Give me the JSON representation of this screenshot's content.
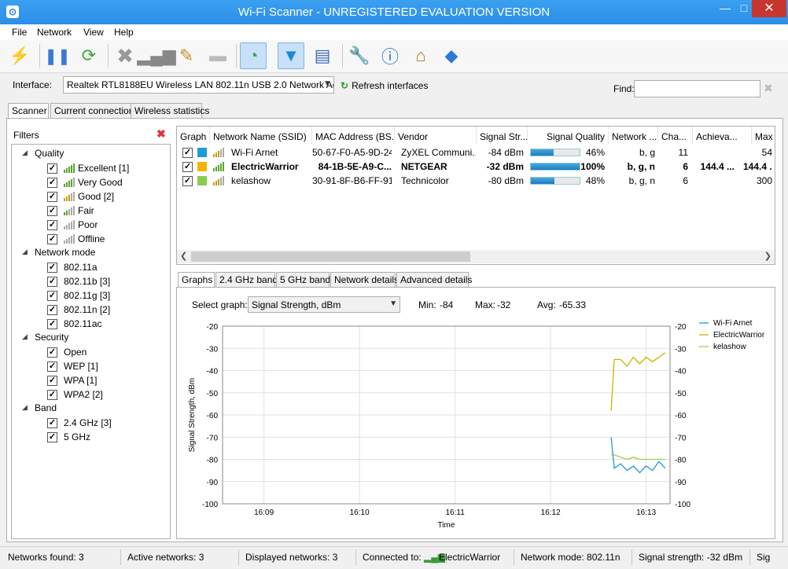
{
  "window": {
    "title": "Wi-Fi Scanner - UNREGISTERED EVALUATION VERSION",
    "minimize": "—",
    "maximize": "□",
    "close": "✕"
  },
  "menu": [
    "File",
    "Network",
    "View",
    "Help"
  ],
  "toolbar": {
    "icons": [
      "power-off-icon",
      "pause-icon",
      "refresh-icon",
      "delete-icon",
      "signal-remove-icon",
      "broom-icon",
      "folder-icon",
      "wifi-scan-icon",
      "filter-icon",
      "notebook-icon",
      "wrench-icon",
      "help-icon",
      "home-icon",
      "info-icon"
    ]
  },
  "interface": {
    "label": "Interface:",
    "value": "Realtek RTL8188EU Wireless LAN 802.11n USB 2.0 Network Adapter",
    "refresh_label": "Refresh interfaces",
    "find_label": "Find:",
    "find_value": ""
  },
  "top_tabs": [
    "Scanner",
    "Current connection",
    "Wireless statistics"
  ],
  "filters": {
    "title": "Filters",
    "groups": [
      {
        "name": "Quality",
        "items": [
          "Excellent [1]",
          "Very Good",
          "Good [2]",
          "Fair",
          "Poor",
          "Offline"
        ]
      },
      {
        "name": "Network mode",
        "items": [
          "802.11a",
          "802.11b [3]",
          "802.11g [3]",
          "802.11n [2]",
          "802.11ac"
        ]
      },
      {
        "name": "Security",
        "items": [
          "Open",
          "WEP [1]",
          "WPA [1]",
          "WPA2 [2]"
        ]
      },
      {
        "name": "Band",
        "items": [
          "2.4 GHz [3]",
          "5 GHz"
        ]
      }
    ]
  },
  "table": {
    "columns": [
      "Graph",
      "Network Name (SSID)",
      "MAC Address (BS...",
      "Vendor",
      "Signal Str...",
      "Signal Quality",
      "Network ...",
      "Cha...",
      "Achieva...",
      "Max"
    ],
    "rows": [
      {
        "color": "#1e9ad6",
        "ssid": "Wi-Fi Arnet",
        "mac": "50-67-F0-A5-9D-24",
        "vendor": "ZyXEL Communi...",
        "signal": "-84 dBm",
        "quality": "46%",
        "quality_value": 46,
        "mode": "b, g",
        "channel": "11",
        "achievable": "",
        "max": "54",
        "bold": false
      },
      {
        "color": "#f2b600",
        "ssid": "ElectricWarrior",
        "mac": "84-1B-5E-A9-C...",
        "vendor": "NETGEAR",
        "signal": "-32 dBm",
        "quality": "100%",
        "quality_value": 100,
        "mode": "b, g, n",
        "channel": "6",
        "achievable": "144.4 ...",
        "max": "144.4 ...",
        "bold": true
      },
      {
        "color": "#8ccc50",
        "ssid": "kelashow",
        "mac": "30-91-8F-B6-FF-91",
        "vendor": "Technicolor",
        "signal": "-80 dBm",
        "quality": "48%",
        "quality_value": 48,
        "mode": "b, g, n",
        "channel": "6",
        "achievable": "",
        "max": "300",
        "bold": false
      }
    ]
  },
  "bottom_tabs": [
    "Graphs",
    "2.4 GHz band",
    "5 GHz band",
    "Network details",
    "Advanced details"
  ],
  "graph": {
    "select_label": "Select graph:",
    "selected": "Signal Strength, dBm",
    "min_label": "Min:",
    "min": "-84",
    "max_label": "Max:",
    "max": "-32",
    "avg_label": "Avg:",
    "avg": "-65.33"
  },
  "chart_data": {
    "type": "line",
    "xlabel": "Time",
    "ylabel": "Signal Strength, dBm",
    "ylim": [
      -100,
      -20
    ],
    "yticks": [
      -20,
      -30,
      -40,
      -50,
      -60,
      -70,
      -80,
      -90,
      -100
    ],
    "xticks": [
      "16:09",
      "16:10",
      "16:11",
      "16:12",
      "16:13"
    ],
    "legend_position": "right",
    "grid": true,
    "series": [
      {
        "name": "Wi-Fi Arnet",
        "color": "#1e9ad6",
        "points": [
          [
            "16:12:38",
            -70
          ],
          [
            "16:12:40",
            -84
          ],
          [
            "16:12:44",
            -82
          ],
          [
            "16:12:48",
            -85
          ],
          [
            "16:12:52",
            -83
          ],
          [
            "16:12:56",
            -86
          ],
          [
            "16:13:00",
            -83
          ],
          [
            "16:13:04",
            -85
          ],
          [
            "16:13:08",
            -81
          ],
          [
            "16:13:12",
            -84
          ]
        ]
      },
      {
        "name": "ElectricWarrior",
        "color": "#c8b400",
        "points": [
          [
            "16:12:38",
            -58
          ],
          [
            "16:12:40",
            -35
          ],
          [
            "16:12:44",
            -35
          ],
          [
            "16:12:48",
            -38
          ],
          [
            "16:12:52",
            -34
          ],
          [
            "16:12:56",
            -37
          ],
          [
            "16:13:00",
            -34
          ],
          [
            "16:13:04",
            -36
          ],
          [
            "16:13:08",
            -34
          ],
          [
            "16:13:12",
            -32
          ]
        ]
      },
      {
        "name": "kelashow",
        "color": "#9acd50",
        "points": [
          [
            "16:12:38",
            -78
          ],
          [
            "16:12:40",
            -78
          ],
          [
            "16:12:44",
            -79
          ],
          [
            "16:12:48",
            -80
          ],
          [
            "16:12:52",
            -79
          ],
          [
            "16:12:56",
            -80
          ],
          [
            "16:13:00",
            -80
          ],
          [
            "16:13:04",
            -80
          ],
          [
            "16:13:08",
            -80
          ],
          [
            "16:13:12",
            -80
          ]
        ]
      }
    ]
  },
  "status": {
    "networks_found": "Networks found: 3",
    "active": "Active networks: 3",
    "displayed": "Displayed networks: 3",
    "connected_label": "Connected to:",
    "connected_value": "ElectricWarrior",
    "mode": "Network mode: 802.11n",
    "strength": "Signal strength: -32 dBm",
    "sig": "Sig"
  }
}
